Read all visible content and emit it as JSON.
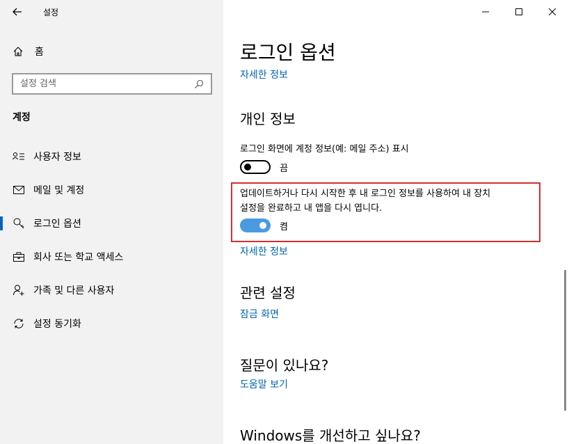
{
  "window": {
    "title": "설정"
  },
  "sidebar": {
    "home_label": "홈",
    "search_placeholder": "설정 검색",
    "section_title": "계정",
    "items": [
      {
        "label": "사용자 정보",
        "icon": "user-info-icon"
      },
      {
        "label": "메일 및 계정",
        "icon": "mail-icon"
      },
      {
        "label": "로그인 옵션",
        "icon": "key-icon",
        "active": true
      },
      {
        "label": "회사 또는 학교 액세스",
        "icon": "briefcase-icon"
      },
      {
        "label": "가족 및 다른 사용자",
        "icon": "person-add-icon"
      },
      {
        "label": "설정 동기화",
        "icon": "sync-icon"
      }
    ]
  },
  "main": {
    "page_title": "로그인 옵션",
    "details_link_top": "자세한 정보",
    "privacy": {
      "heading": "개인 정보",
      "setting1_label": "로그인 화면에 계정 정보(예: 메일 주소) 표시",
      "setting1_state": "끔",
      "setting2_label_line1": "업데이트하거나 다시 시작한 후 내 로그인 정보를 사용하여 내 장치",
      "setting2_label_line2": "설정을 완료하고 내 앱을 다시 엽니다.",
      "setting2_state": "켬",
      "details_link": "자세한 정보"
    },
    "related": {
      "heading": "관련 설정",
      "link": "잠금 화면"
    },
    "help": {
      "heading": "질문이 있나요?",
      "link": "도움말 보기"
    },
    "feedback": {
      "heading": "Windows를 개선하고 싶나요?"
    }
  },
  "colors": {
    "accent": "#0063b1",
    "toggle_on": "#4a9ae2",
    "highlight": "#d32f2f"
  }
}
